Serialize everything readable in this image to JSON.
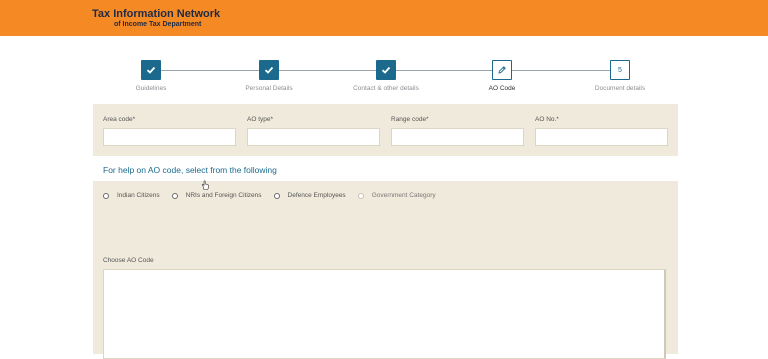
{
  "header": {
    "title": "Tax Information Network",
    "subtitle": "of Income Tax Department",
    "user_line1": "",
    "user_line2": ""
  },
  "stepper": {
    "steps": [
      {
        "label": "Guidelines",
        "state": "done",
        "icon": "check-icon"
      },
      {
        "label": "Personal Details",
        "state": "done",
        "icon": "check-icon"
      },
      {
        "label": "Contact & other details",
        "state": "done",
        "icon": "check-icon"
      },
      {
        "label": "AO Code",
        "state": "current",
        "icon": "pencil-icon"
      },
      {
        "label": "Document details",
        "state": "todo",
        "number": "5"
      }
    ]
  },
  "ao_fields": {
    "area_code_label": "Area code*",
    "ao_type_label": "AO type*",
    "range_code_label": "Range code*",
    "ao_no_label": "AO No.*",
    "area_code_value": "",
    "ao_type_value": "",
    "range_code_value": "",
    "ao_no_value": ""
  },
  "help": {
    "text": "For help on AO code, select from the following"
  },
  "categories": {
    "options": [
      "Indian Citizens",
      "NRIs and Foreign Citizens",
      "Defence Employees",
      "Government Category"
    ],
    "selected": null
  },
  "choose": {
    "label": "Choose AO Code",
    "value": ""
  },
  "colors": {
    "header_bg": "#f58a24",
    "step_done": "#1b6a8e",
    "panel_bg": "#efeadb",
    "link": "#1b6a8e"
  }
}
